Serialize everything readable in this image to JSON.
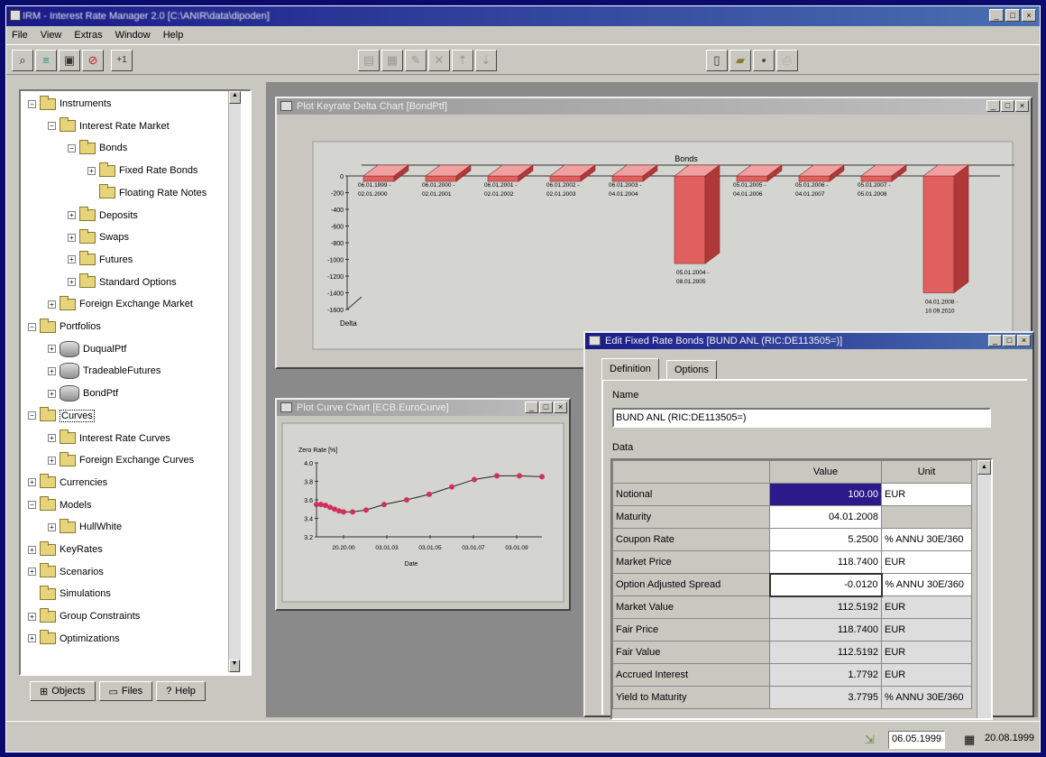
{
  "window": {
    "title": "IRM - Interest Rate Manager 2.0 [C:\\ANIR\\data\\dipoden]"
  },
  "menu": [
    "File",
    "View",
    "Extras",
    "Window",
    "Help"
  ],
  "tree": [
    {
      "label": "Instruments",
      "exp": "-",
      "icon": "folder",
      "level": 0
    },
    {
      "label": "Interest Rate Market",
      "exp": "-",
      "icon": "folder",
      "level": 1
    },
    {
      "label": "Bonds",
      "exp": "-",
      "icon": "folder",
      "level": 2
    },
    {
      "label": "Fixed Rate Bonds",
      "exp": "+",
      "icon": "folder",
      "level": 3
    },
    {
      "label": "Floating Rate Notes",
      "exp": "",
      "icon": "folder",
      "level": 3
    },
    {
      "label": "Deposits",
      "exp": "+",
      "icon": "folder",
      "level": 2
    },
    {
      "label": "Swaps",
      "exp": "+",
      "icon": "folder",
      "level": 2
    },
    {
      "label": "Futures",
      "exp": "+",
      "icon": "folder",
      "level": 2
    },
    {
      "label": "Standard Options",
      "exp": "+",
      "icon": "folder",
      "level": 2
    },
    {
      "label": "Foreign Exchange Market",
      "exp": "+",
      "icon": "folder",
      "level": 1
    },
    {
      "label": "Portfolios",
      "exp": "-",
      "icon": "folder",
      "level": 0
    },
    {
      "label": "DuqualPtf",
      "exp": "+",
      "icon": "db",
      "level": 1
    },
    {
      "label": "TradeableFutures",
      "exp": "+",
      "icon": "db",
      "level": 1
    },
    {
      "label": "BondPtf",
      "exp": "+",
      "icon": "db",
      "level": 1
    },
    {
      "label": "Curves",
      "exp": "-",
      "icon": "folder",
      "level": 0,
      "selected": true
    },
    {
      "label": "Interest Rate Curves",
      "exp": "+",
      "icon": "folder",
      "level": 1
    },
    {
      "label": "Foreign Exchange Curves",
      "exp": "+",
      "icon": "folder",
      "level": 1
    },
    {
      "label": "Currencies",
      "exp": "+",
      "icon": "folder",
      "level": 0
    },
    {
      "label": "Models",
      "exp": "-",
      "icon": "folder",
      "level": 0
    },
    {
      "label": "HullWhite",
      "exp": "+",
      "icon": "folder",
      "level": 1
    },
    {
      "label": "KeyRates",
      "exp": "+",
      "icon": "folder",
      "level": 0
    },
    {
      "label": "Scenarios",
      "exp": "+",
      "icon": "folder",
      "level": 0
    },
    {
      "label": "Simulations",
      "exp": "",
      "icon": "folder",
      "level": 0
    },
    {
      "label": "Group Constraints",
      "exp": "+",
      "icon": "folder",
      "level": 0
    },
    {
      "label": "Optimizations",
      "exp": "+",
      "icon": "folder",
      "level": 0
    }
  ],
  "bottom_tabs": {
    "objects": "Objects",
    "files": "Files",
    "help": "Help"
  },
  "delta_window": {
    "title": "Plot Keyrate Delta Chart [BondPtf]"
  },
  "curve_window": {
    "title": "Plot Curve Chart [ECB.EuroCurve]"
  },
  "edit_window": {
    "title": "Edit Fixed Rate Bonds [BUND ANL (RIC:DE113505=)]",
    "tabs": [
      "Definition",
      "Options"
    ],
    "name_label": "Name",
    "name_value": "BUND ANL (RIC:DE113505=)",
    "data_label": "Data",
    "col_value": "Value",
    "col_unit": "Unit",
    "rows": [
      {
        "label": "Notional",
        "value": "100.00",
        "unit": "EUR"
      },
      {
        "label": "Maturity",
        "value": "04.01.2008",
        "unit": ""
      },
      {
        "label": "Coupon Rate",
        "value": "5.2500",
        "unit": "% ANNU 30E/360"
      },
      {
        "label": "Market Price",
        "value": "118.7400",
        "unit": "EUR"
      },
      {
        "label": "Option Adjusted Spread",
        "value": "-0.0120",
        "unit": "% ANNU 30E/360"
      },
      {
        "label": "Market Value",
        "value": "112.5192",
        "unit": "EUR"
      },
      {
        "label": "Fair Price",
        "value": "118.7400",
        "unit": "EUR"
      },
      {
        "label": "Fair Value",
        "value": "112.5192",
        "unit": "EUR"
      },
      {
        "label": "Accrued Interest",
        "value": "1.7792",
        "unit": "EUR"
      },
      {
        "label": "Yield to Maturity",
        "value": "3.7795",
        "unit": "% ANNU 30E/360"
      }
    ]
  },
  "status": {
    "date1": "06.05.1999",
    "date2": "20.08.1999"
  },
  "chart_data": [
    {
      "type": "bar",
      "title": "Bonds",
      "xlabel": "",
      "ylabel": "Delta",
      "ylim": [
        -1600,
        0
      ],
      "yticks": [
        0,
        -200,
        -400,
        -600,
        -800,
        -1000,
        -1200,
        -1400,
        -1600
      ],
      "categories": [
        "06.01.1999 - 02.01.2000",
        "06.01.2000 - 02.01.2001",
        "06.01.2001 - 02.01.2002",
        "06.01.2002 - 02.01.2003",
        "06.01.2003 - 04.01.2004",
        "05.01.2004 - 08.01.2005",
        "05.01.2005 - 04.01.2006",
        "05.01.2006 - 04.01.2007",
        "05.01.2007 - 05.01.2008",
        "04.01.2008 - 10.09.2010"
      ],
      "values": [
        -10,
        -10,
        -10,
        -10,
        -15,
        -1050,
        -10,
        -10,
        -10,
        -1400
      ]
    },
    {
      "type": "line",
      "title": "",
      "ylabel": "Zero Rate [%]",
      "xlabel": "Date",
      "ylim": [
        3.2,
        4.0
      ],
      "yticks": [
        3.2,
        3.4,
        3.6,
        3.8,
        4.0
      ],
      "xticks": [
        "20.20.00",
        "03.01.03",
        "03.01.05",
        "03.01.07",
        "03.01.09"
      ],
      "x": [
        0.0,
        0.02,
        0.04,
        0.06,
        0.08,
        0.1,
        0.12,
        0.16,
        0.22,
        0.3,
        0.4,
        0.5,
        0.6,
        0.7,
        0.8,
        0.9,
        1.0
      ],
      "y": [
        3.55,
        3.55,
        3.54,
        3.52,
        3.5,
        3.48,
        3.47,
        3.47,
        3.49,
        3.55,
        3.6,
        3.66,
        3.74,
        3.82,
        3.86,
        3.86,
        3.85
      ]
    }
  ]
}
